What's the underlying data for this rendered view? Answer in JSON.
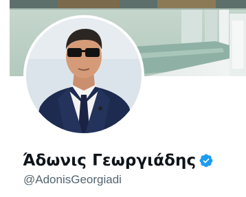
{
  "profile": {
    "display_name": "Άδωνις Γεωργιάδης",
    "handle": "@AdonisGeorgiadi",
    "verified": true
  },
  "banner": {
    "content": "office-interior-photo"
  },
  "avatar": {
    "content": "profile-photo"
  },
  "icons": {
    "verified": "verified-badge-icon"
  },
  "colors": {
    "name_text": "#0f1419",
    "handle_text": "#536471",
    "verified_badge": "#1d9bf0",
    "background": "#ffffff"
  }
}
